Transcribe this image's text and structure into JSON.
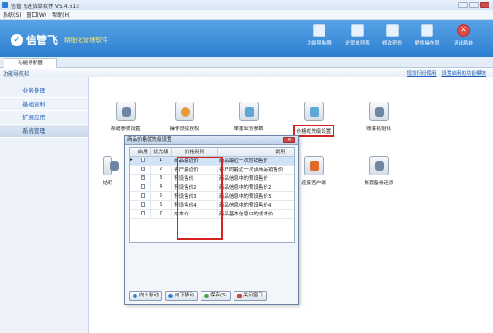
{
  "window": {
    "title": "信管飞进货单软件 V5.4.613"
  },
  "menu": [
    "系统(S)",
    "窗口(W)",
    "帮助(H)"
  ],
  "banner": {
    "logo": "信管飞",
    "slogan": "精细化管理软件",
    "buttons": [
      {
        "label": "功能导航器",
        "icon": "monitor-icon"
      },
      {
        "label": "进货单列表",
        "icon": "list-icon"
      },
      {
        "label": "修改密码",
        "icon": "key-icon"
      },
      {
        "label": "更换操作员",
        "icon": "user-swap-icon"
      },
      {
        "label": "退出系统",
        "icon": "exit-icon"
      }
    ]
  },
  "tab": {
    "label": "功能导航器"
  },
  "navbar": {
    "title": "功能导航栏",
    "links": [
      "增加扫码使用",
      "设置启用的功能模块"
    ]
  },
  "sidebar": {
    "items": [
      "业务处理",
      "基础资料",
      "扩展应用",
      "系统管理"
    ],
    "active_index": 3
  },
  "modules": [
    {
      "label": "系统参数设置"
    },
    {
      "label": "操作员及授权"
    },
    {
      "label": "单据业务参数"
    },
    {
      "label": "价格优先级设置"
    },
    {
      "label": "账套初始化"
    },
    {
      "label": "结转"
    },
    {
      "label": "连接客户端"
    },
    {
      "label": "账套备份还原"
    }
  ],
  "dialog": {
    "title": "商品价格优先级设置",
    "columns": [
      "启用",
      "优先级",
      "价格类别",
      "说明"
    ],
    "rows": [
      {
        "enabled": false,
        "priority": "1",
        "type": "商品最近价",
        "desc": "商品最近一次的销售价"
      },
      {
        "enabled": true,
        "priority": "2",
        "type": "客户最近价",
        "desc": "客户的最近一次该商品销售价"
      },
      {
        "enabled": true,
        "priority": "3",
        "type": "预设售价",
        "desc": "商品信息中的预设售价"
      },
      {
        "enabled": false,
        "priority": "4",
        "type": "预设售价2",
        "desc": "商品信息中的预设售价2"
      },
      {
        "enabled": false,
        "priority": "5",
        "type": "预设售价3",
        "desc": "商品信息中的预设售价3"
      },
      {
        "enabled": false,
        "priority": "6",
        "type": "预设售价4",
        "desc": "商品信息中的预设售价4"
      },
      {
        "enabled": false,
        "priority": "7",
        "type": "成本价",
        "desc": "商品基本信息中的成本价"
      }
    ],
    "buttons": {
      "up": "向上移动",
      "down": "向下移动",
      "save": "保存(S)",
      "close": "关闭窗口"
    }
  }
}
